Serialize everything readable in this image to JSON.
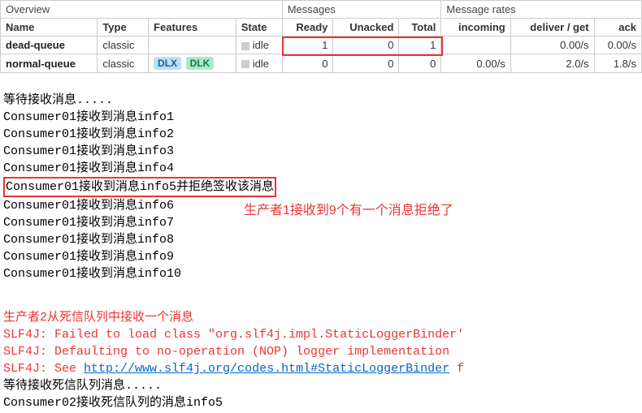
{
  "table": {
    "sections": {
      "overview": "Overview",
      "messages": "Messages",
      "rates": "Message rates"
    },
    "headers": {
      "name": "Name",
      "type": "Type",
      "features": "Features",
      "state": "State",
      "ready": "Ready",
      "unacked": "Unacked",
      "total": "Total",
      "incoming": "incoming",
      "deliver": "deliver / get",
      "ack": "ack"
    },
    "rows": [
      {
        "name": "dead-queue",
        "type": "classic",
        "features": [],
        "state": "idle",
        "ready": "1",
        "unacked": "0",
        "total": "1",
        "incoming": "",
        "deliver": "0.00/s",
        "ack": "0.00/s",
        "highlight_msgs": true
      },
      {
        "name": "normal-queue",
        "type": "classic",
        "features": [
          "DLX",
          "DLK"
        ],
        "state": "idle",
        "ready": "0",
        "unacked": "0",
        "total": "0",
        "incoming": "0.00/s",
        "deliver": "2.0/s",
        "ack": "1.8/s",
        "highlight_msgs": false
      }
    ]
  },
  "console1": {
    "lines": [
      "等待接收消息.....",
      "Consumer01接收到消息info1",
      "Consumer01接收到消息info2",
      "Consumer01接收到消息info3",
      "Consumer01接收到消息info4"
    ],
    "boxed": "Consumer01接收到消息info5并拒绝签收该消息",
    "lines2": [
      "Consumer01接收到消息info6",
      "Consumer01接收到消息info7",
      "Consumer01接收到消息info8",
      "Consumer01接收到消息info9",
      "Consumer01接收到消息info10"
    ],
    "annotation": "生产者1接收到9个有一个消息拒绝了"
  },
  "console2": {
    "heading": "生产者2从死信队列中接收一个消息",
    "slf1": "SLF4J: Failed to load class \"org.slf4j.impl.StaticLoggerBinder'",
    "slf2": "SLF4J: Defaulting to no-operation (NOP) logger implementation",
    "slf3a": "SLF4J: See ",
    "slf3link": "http://www.slf4j.org/codes.html#StaticLoggerBinder",
    "slf3b": " f",
    "wait": "等待接收死信队列消息.....",
    "recv": "Consumer02接收死信队列的消息info5"
  }
}
